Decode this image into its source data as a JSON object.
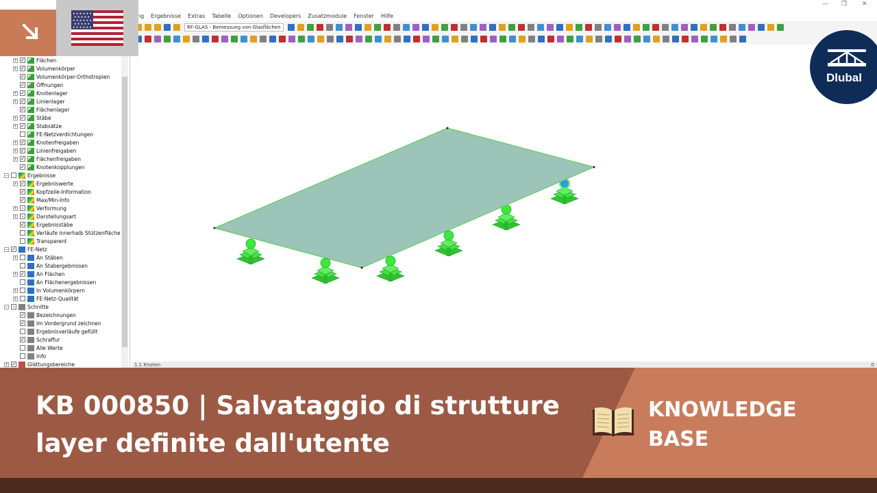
{
  "menu": [
    "ung",
    "Ergebnisse",
    "Extras",
    "Tabelle",
    "Optionen",
    "Developers",
    "Zusatzmodule",
    "Fenster",
    "Hilfe"
  ],
  "toolbar": {
    "module_dropdown": "RF-GLAS - Bemessung von Glasflächen"
  },
  "navigator": {
    "items": [
      {
        "label": "Flächen",
        "level": 1,
        "checked": true,
        "expand": "+",
        "icon": "green-check-icon"
      },
      {
        "label": "Volumenkörper",
        "level": 1,
        "checked": true,
        "expand": "+",
        "icon": "green-check-icon"
      },
      {
        "label": "Volumenkörper-Orthotropien",
        "level": 1,
        "checked": true,
        "expand": "",
        "icon": "green-check-icon"
      },
      {
        "label": "Öffnungen",
        "level": 1,
        "checked": true,
        "expand": "",
        "icon": "green-check-icon"
      },
      {
        "label": "Knotenlager",
        "level": 1,
        "checked": true,
        "expand": "+",
        "icon": "green-check-icon"
      },
      {
        "label": "Linienlager",
        "level": 1,
        "checked": true,
        "expand": "+",
        "icon": "green-check-icon"
      },
      {
        "label": "Flächenlager",
        "level": 1,
        "checked": true,
        "expand": "",
        "icon": "green-check-icon"
      },
      {
        "label": "Stäbe",
        "level": 1,
        "checked": true,
        "expand": "+",
        "icon": "green-check-icon"
      },
      {
        "label": "Stabsätze",
        "level": 1,
        "checked": true,
        "expand": "+",
        "icon": "green-check-icon"
      },
      {
        "label": "FE-Netzverdichtungen",
        "level": 1,
        "checked": false,
        "expand": "",
        "icon": "green-check-icon"
      },
      {
        "label": "Knotenfreigaben",
        "level": 1,
        "checked": true,
        "expand": "+",
        "icon": "green-check-icon"
      },
      {
        "label": "Linienfreigaben",
        "level": 1,
        "checked": true,
        "expand": "+",
        "icon": "green-check-icon"
      },
      {
        "label": "Flächenfreigaben",
        "level": 1,
        "checked": true,
        "expand": "+",
        "icon": "green-check-icon"
      },
      {
        "label": "Knotenkopplungen",
        "level": 1,
        "checked": true,
        "expand": "",
        "icon": "green-check-icon"
      },
      {
        "label": "Ergebnisse",
        "level": 0,
        "checked": false,
        "expand": "−",
        "icon": "results-icon"
      },
      {
        "label": "Ergebniswerte",
        "level": 1,
        "checked": true,
        "expand": "+",
        "icon": "results-icon"
      },
      {
        "label": "Kopfzeile-Information",
        "level": 1,
        "checked": true,
        "expand": "",
        "icon": "results-icon"
      },
      {
        "label": "Max/Min-Info",
        "level": 1,
        "checked": true,
        "expand": "",
        "icon": "results-icon"
      },
      {
        "label": "Verformung",
        "level": 1,
        "checked": "partial",
        "expand": "+",
        "icon": "results-icon"
      },
      {
        "label": "Darstellungsart",
        "level": 1,
        "checked": "partial",
        "expand": "+",
        "icon": "results-icon"
      },
      {
        "label": "Ergebnisstäbe",
        "level": 1,
        "checked": true,
        "expand": "",
        "icon": "results-icon"
      },
      {
        "label": "Verläufe innerhalb Stützenfläche",
        "level": 1,
        "checked": false,
        "expand": "",
        "icon": "results-icon"
      },
      {
        "label": "Transparent",
        "level": 1,
        "checked": false,
        "expand": "",
        "icon": "results-icon"
      },
      {
        "label": "FE-Netz",
        "level": 0,
        "checked": true,
        "expand": "−",
        "icon": "mesh-icon"
      },
      {
        "label": "An Stäben",
        "level": 1,
        "checked": false,
        "expand": "+",
        "icon": "mesh-icon"
      },
      {
        "label": "An Stabergebnissen",
        "level": 1,
        "checked": false,
        "expand": "",
        "icon": "mesh-icon"
      },
      {
        "label": "An Flächen",
        "level": 1,
        "checked": true,
        "expand": "+",
        "icon": "mesh-icon"
      },
      {
        "label": "An Flächenergebnissen",
        "level": 1,
        "checked": false,
        "expand": "",
        "icon": "mesh-icon"
      },
      {
        "label": "In Volumenkörpern",
        "level": 1,
        "checked": false,
        "expand": "+",
        "icon": "mesh-icon"
      },
      {
        "label": "FE-Netz-Qualität",
        "level": 1,
        "checked": false,
        "expand": "+",
        "icon": "mesh-icon"
      },
      {
        "label": "Schnitte",
        "level": 0,
        "checked": "partial",
        "expand": "−",
        "icon": "section-icon"
      },
      {
        "label": "Bezeichnungen",
        "level": 1,
        "checked": true,
        "expand": "",
        "icon": "section-icon"
      },
      {
        "label": "Im Vordergrund zeichnen",
        "level": 1,
        "checked": true,
        "expand": "",
        "icon": "section-icon"
      },
      {
        "label": "Ergebnisverläufe gefüllt",
        "level": 1,
        "checked": false,
        "expand": "",
        "icon": "section-icon"
      },
      {
        "label": "Schraffur",
        "level": 1,
        "checked": true,
        "expand": "",
        "icon": "section-icon"
      },
      {
        "label": "Alle Werte",
        "level": 1,
        "checked": false,
        "expand": "",
        "icon": "section-icon"
      },
      {
        "label": "Info",
        "level": 1,
        "checked": false,
        "expand": "",
        "icon": "section-icon"
      },
      {
        "label": "Glättungsbereiche",
        "level": 0,
        "checked": true,
        "expand": "+",
        "icon": "smoothing-icon"
      }
    ]
  },
  "status": {
    "left": "1.1 Knoten",
    "right": "0"
  },
  "banner": {
    "title_line1": "KB 000850 | Salvataggio di strutture",
    "title_line2": "layer definite dall'utente",
    "kb_line1": "KNOWLEDGE",
    "kb_line2": "BASE"
  },
  "logo": {
    "text": "Dlubal"
  },
  "colors": {
    "banner_dark": "#9c5a44",
    "banner_light": "#c87c5c",
    "footer": "#4b2a1f",
    "logo_bg": "#0f2c59",
    "plate": "#9dc4b8",
    "support": "#3ee83e"
  }
}
